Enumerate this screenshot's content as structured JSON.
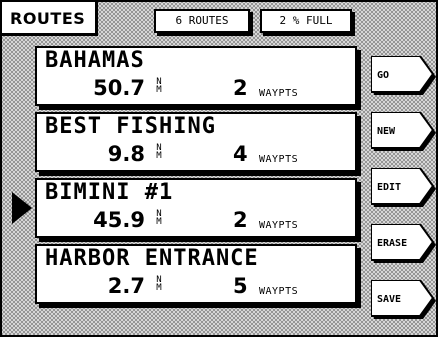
{
  "header": {
    "title": "ROUTES",
    "route_count": "6 ROUTES",
    "memory_used": "2 % FULL"
  },
  "routes": [
    {
      "name": "BAHAMAS",
      "distance": "50.7",
      "distance_unit": "NM",
      "waypoints": "2",
      "waypoints_label": "WAYPTS"
    },
    {
      "name": "BEST FISHING",
      "distance": "9.8",
      "distance_unit": "NM",
      "waypoints": "4",
      "waypoints_label": "WAYPTS"
    },
    {
      "name": "BIMINI #1",
      "distance": "45.9",
      "distance_unit": "NM",
      "waypoints": "2",
      "waypoints_label": "WAYPTS"
    },
    {
      "name": "HARBOR ENTRANCE",
      "distance": "2.7",
      "distance_unit": "NM",
      "waypoints": "5",
      "waypoints_label": "WAYPTS"
    }
  ],
  "selection": {
    "selected_route": "BIMINI #1"
  },
  "softkeys": [
    {
      "label": "GO"
    },
    {
      "label": "NEW"
    },
    {
      "label": "EDIT"
    },
    {
      "label": "ERASE"
    },
    {
      "label": "SAVE"
    }
  ],
  "icons": {
    "selector": "selector-arrow-icon"
  }
}
